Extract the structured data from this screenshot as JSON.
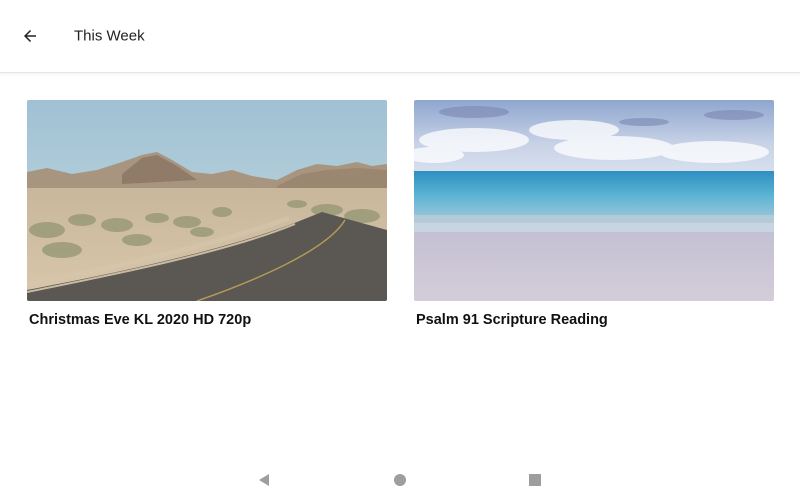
{
  "header": {
    "title": "This Week",
    "back_icon": "arrow-left-icon"
  },
  "videos": [
    {
      "title": "Christmas Eve KL 2020 HD 720p",
      "thumbnail": "desert-road-thumbnail"
    },
    {
      "title": "Psalm 91 Scripture Reading",
      "thumbnail": "ocean-beach-thumbnail"
    }
  ],
  "system_nav": {
    "back_icon": "nav-back-triangle-icon",
    "home_icon": "nav-home-circle-icon",
    "recents_icon": "nav-recents-square-icon",
    "icon_color": "#9e9e9e"
  }
}
